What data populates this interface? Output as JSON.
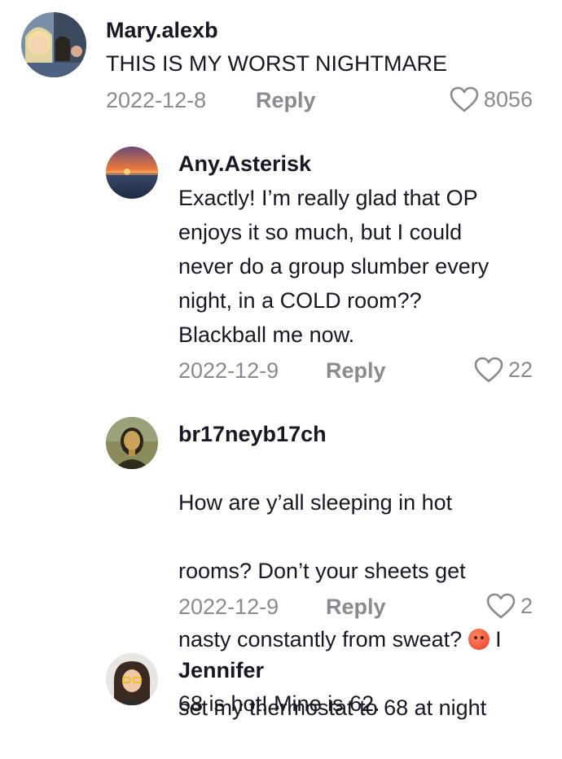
{
  "comments": [
    {
      "username": "Mary.alexb",
      "text": "THIS IS MY WORST NIGHTMARE",
      "date": "2022-12-8",
      "reply_label": "Reply",
      "likes": "8056"
    },
    {
      "username": "Any.Asterisk",
      "text": "Exactly! I’m really glad that OP\nenjoys it so much, but I could\nnever do a group slumber every\nnight, in a COLD room??\nBlackball me now.",
      "date": "2022-12-9",
      "reply_label": "Reply",
      "likes": "22"
    },
    {
      "username": "br17neyb17ch",
      "text_line1": "How are y’all sleeping in hot",
      "text_line2": "rooms? Don’t your sheets get",
      "text_line3_a": "nasty constantly from sweat? ",
      "text_line3_b": " I",
      "text_line4": "set my thermostat to 68 at night",
      "emoji": "hot-face-emoji",
      "date": "2022-12-9",
      "reply_label": "Reply",
      "likes": "2"
    },
    {
      "username": "Jennifer",
      "text": "68 is hot! Mine is 62."
    }
  ],
  "colors": {
    "text": "#161823",
    "muted": "#8a8b91"
  }
}
